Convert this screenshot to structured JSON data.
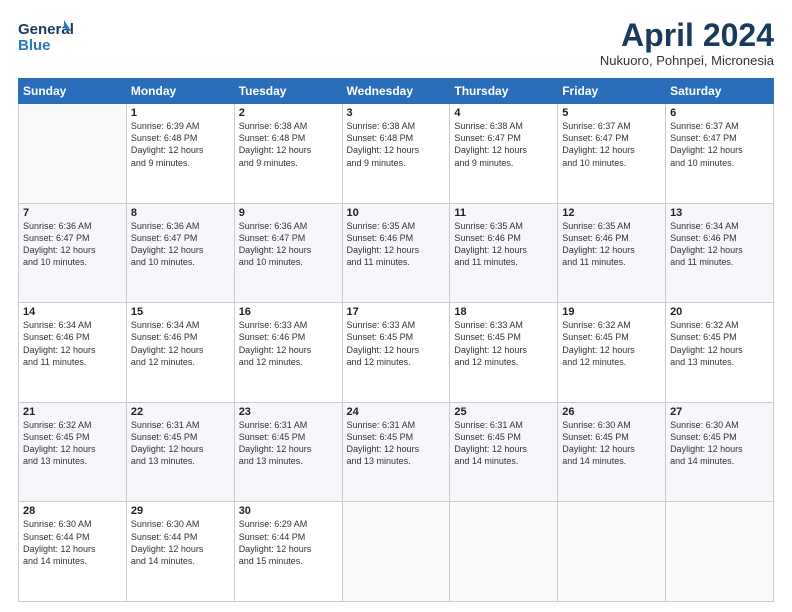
{
  "header": {
    "logo_line1": "General",
    "logo_line2": "Blue",
    "title": "April 2024",
    "subtitle": "Nukuoro, Pohnpei, Micronesia"
  },
  "weekdays": [
    "Sunday",
    "Monday",
    "Tuesday",
    "Wednesday",
    "Thursday",
    "Friday",
    "Saturday"
  ],
  "weeks": [
    [
      {
        "day": "",
        "info": ""
      },
      {
        "day": "1",
        "info": "Sunrise: 6:39 AM\nSunset: 6:48 PM\nDaylight: 12 hours\nand 9 minutes."
      },
      {
        "day": "2",
        "info": "Sunrise: 6:38 AM\nSunset: 6:48 PM\nDaylight: 12 hours\nand 9 minutes."
      },
      {
        "day": "3",
        "info": "Sunrise: 6:38 AM\nSunset: 6:48 PM\nDaylight: 12 hours\nand 9 minutes."
      },
      {
        "day": "4",
        "info": "Sunrise: 6:38 AM\nSunset: 6:47 PM\nDaylight: 12 hours\nand 9 minutes."
      },
      {
        "day": "5",
        "info": "Sunrise: 6:37 AM\nSunset: 6:47 PM\nDaylight: 12 hours\nand 10 minutes."
      },
      {
        "day": "6",
        "info": "Sunrise: 6:37 AM\nSunset: 6:47 PM\nDaylight: 12 hours\nand 10 minutes."
      }
    ],
    [
      {
        "day": "7",
        "info": "Sunrise: 6:36 AM\nSunset: 6:47 PM\nDaylight: 12 hours\nand 10 minutes."
      },
      {
        "day": "8",
        "info": "Sunrise: 6:36 AM\nSunset: 6:47 PM\nDaylight: 12 hours\nand 10 minutes."
      },
      {
        "day": "9",
        "info": "Sunrise: 6:36 AM\nSunset: 6:47 PM\nDaylight: 12 hours\nand 10 minutes."
      },
      {
        "day": "10",
        "info": "Sunrise: 6:35 AM\nSunset: 6:46 PM\nDaylight: 12 hours\nand 11 minutes."
      },
      {
        "day": "11",
        "info": "Sunrise: 6:35 AM\nSunset: 6:46 PM\nDaylight: 12 hours\nand 11 minutes."
      },
      {
        "day": "12",
        "info": "Sunrise: 6:35 AM\nSunset: 6:46 PM\nDaylight: 12 hours\nand 11 minutes."
      },
      {
        "day": "13",
        "info": "Sunrise: 6:34 AM\nSunset: 6:46 PM\nDaylight: 12 hours\nand 11 minutes."
      }
    ],
    [
      {
        "day": "14",
        "info": "Sunrise: 6:34 AM\nSunset: 6:46 PM\nDaylight: 12 hours\nand 11 minutes."
      },
      {
        "day": "15",
        "info": "Sunrise: 6:34 AM\nSunset: 6:46 PM\nDaylight: 12 hours\nand 12 minutes."
      },
      {
        "day": "16",
        "info": "Sunrise: 6:33 AM\nSunset: 6:46 PM\nDaylight: 12 hours\nand 12 minutes."
      },
      {
        "day": "17",
        "info": "Sunrise: 6:33 AM\nSunset: 6:45 PM\nDaylight: 12 hours\nand 12 minutes."
      },
      {
        "day": "18",
        "info": "Sunrise: 6:33 AM\nSunset: 6:45 PM\nDaylight: 12 hours\nand 12 minutes."
      },
      {
        "day": "19",
        "info": "Sunrise: 6:32 AM\nSunset: 6:45 PM\nDaylight: 12 hours\nand 12 minutes."
      },
      {
        "day": "20",
        "info": "Sunrise: 6:32 AM\nSunset: 6:45 PM\nDaylight: 12 hours\nand 13 minutes."
      }
    ],
    [
      {
        "day": "21",
        "info": "Sunrise: 6:32 AM\nSunset: 6:45 PM\nDaylight: 12 hours\nand 13 minutes."
      },
      {
        "day": "22",
        "info": "Sunrise: 6:31 AM\nSunset: 6:45 PM\nDaylight: 12 hours\nand 13 minutes."
      },
      {
        "day": "23",
        "info": "Sunrise: 6:31 AM\nSunset: 6:45 PM\nDaylight: 12 hours\nand 13 minutes."
      },
      {
        "day": "24",
        "info": "Sunrise: 6:31 AM\nSunset: 6:45 PM\nDaylight: 12 hours\nand 13 minutes."
      },
      {
        "day": "25",
        "info": "Sunrise: 6:31 AM\nSunset: 6:45 PM\nDaylight: 12 hours\nand 14 minutes."
      },
      {
        "day": "26",
        "info": "Sunrise: 6:30 AM\nSunset: 6:45 PM\nDaylight: 12 hours\nand 14 minutes."
      },
      {
        "day": "27",
        "info": "Sunrise: 6:30 AM\nSunset: 6:45 PM\nDaylight: 12 hours\nand 14 minutes."
      }
    ],
    [
      {
        "day": "28",
        "info": "Sunrise: 6:30 AM\nSunset: 6:44 PM\nDaylight: 12 hours\nand 14 minutes."
      },
      {
        "day": "29",
        "info": "Sunrise: 6:30 AM\nSunset: 6:44 PM\nDaylight: 12 hours\nand 14 minutes."
      },
      {
        "day": "30",
        "info": "Sunrise: 6:29 AM\nSunset: 6:44 PM\nDaylight: 12 hours\nand 15 minutes."
      },
      {
        "day": "",
        "info": ""
      },
      {
        "day": "",
        "info": ""
      },
      {
        "day": "",
        "info": ""
      },
      {
        "day": "",
        "info": ""
      }
    ]
  ]
}
